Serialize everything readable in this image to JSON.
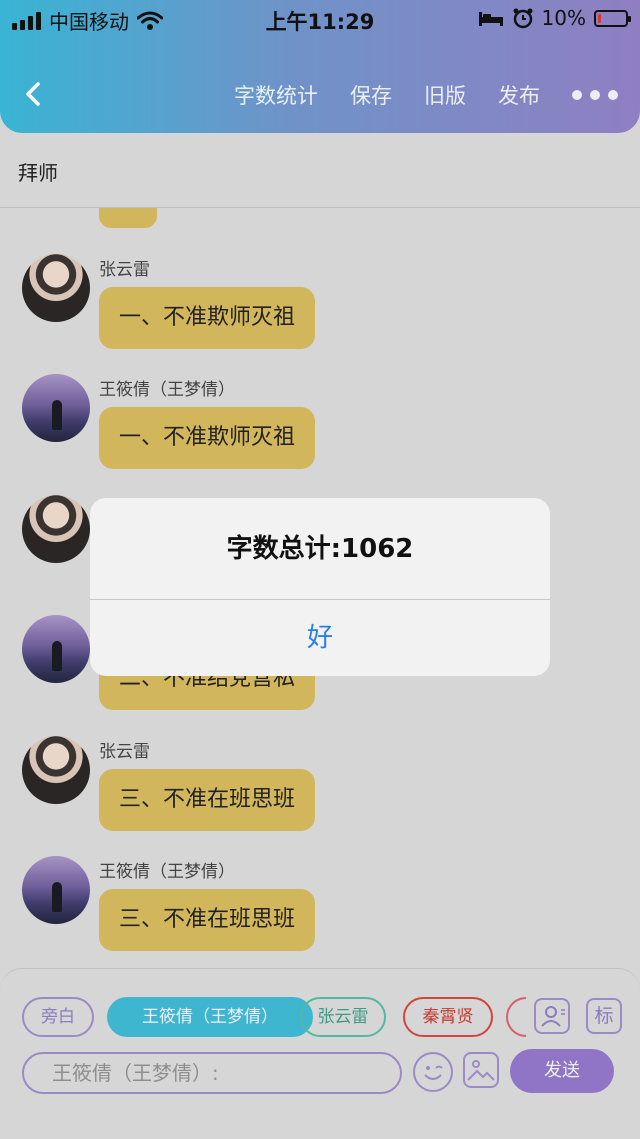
{
  "status_bar": {
    "carrier": "中国移动",
    "time": "上午11:29",
    "battery_percent": "10%",
    "battery_level": 0.1,
    "battery_color": "#e0332b"
  },
  "nav": {
    "back_icon": "chevron-left-icon",
    "actions": [
      "字数统计",
      "保存",
      "旧版",
      "发布"
    ],
    "more_icon": "more-dots-icon"
  },
  "title": "拜师",
  "messages": [
    {
      "sender": "张云雷",
      "text": "一、不准欺师灭祖",
      "avatar": "male"
    },
    {
      "sender": "王筱倩（王梦倩）",
      "text": "一、不准欺师灭祖",
      "avatar": "female"
    },
    {
      "sender": "",
      "text": "",
      "avatar": "male"
    },
    {
      "sender": "",
      "text": "二、不准结党营私",
      "avatar": "female"
    },
    {
      "sender": "张云雷",
      "text": "三、不准在班思班",
      "avatar": "male"
    },
    {
      "sender": "王筱倩（王梦倩）",
      "text": "三、不准在班思班",
      "avatar": "female"
    }
  ],
  "roles": {
    "narrator": "旁白",
    "selected": "王筱倩（王梦倩）",
    "role2": "张云雷",
    "role3": "秦霄贤"
  },
  "toolbar": {
    "tag_label": "标",
    "input_placeholder": "王筱倩（王梦倩）:",
    "send_label": "发送"
  },
  "dialog": {
    "message": "字数总计:1062",
    "ok_label": "好"
  },
  "colors": {
    "bubble": "#d2b65c",
    "accent_purple": "#9075c6",
    "selected_chip": "#3fb6cf",
    "dialog_button": "#2a7ee8"
  }
}
